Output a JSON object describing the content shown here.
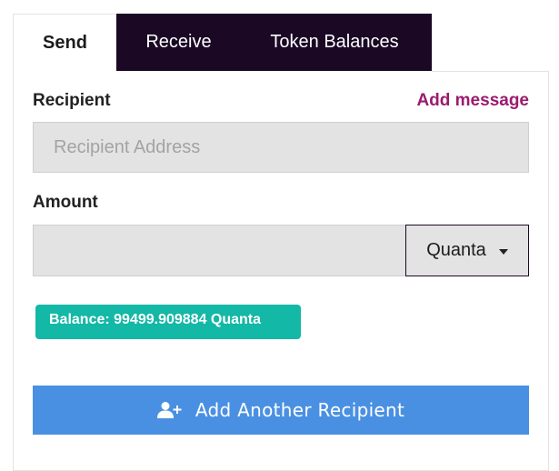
{
  "tabs": [
    {
      "label": "Send"
    },
    {
      "label": "Receive"
    },
    {
      "label": "Token Balances"
    }
  ],
  "recipient": {
    "label": "Recipient",
    "add_message": "Add message",
    "placeholder": "Recipient Address"
  },
  "amount": {
    "label": "Amount",
    "value": "",
    "unit": "Quanta"
  },
  "balance": {
    "text": "Balance: 99499.909884 Quanta"
  },
  "add_recipient": {
    "label": "Add Another Recipient",
    "icon": "add-user-icon"
  },
  "colors": {
    "tab_dark": "#1a0825",
    "link": "#9b1b6e",
    "badge": "#14b8a6",
    "button": "#4a90e2"
  }
}
